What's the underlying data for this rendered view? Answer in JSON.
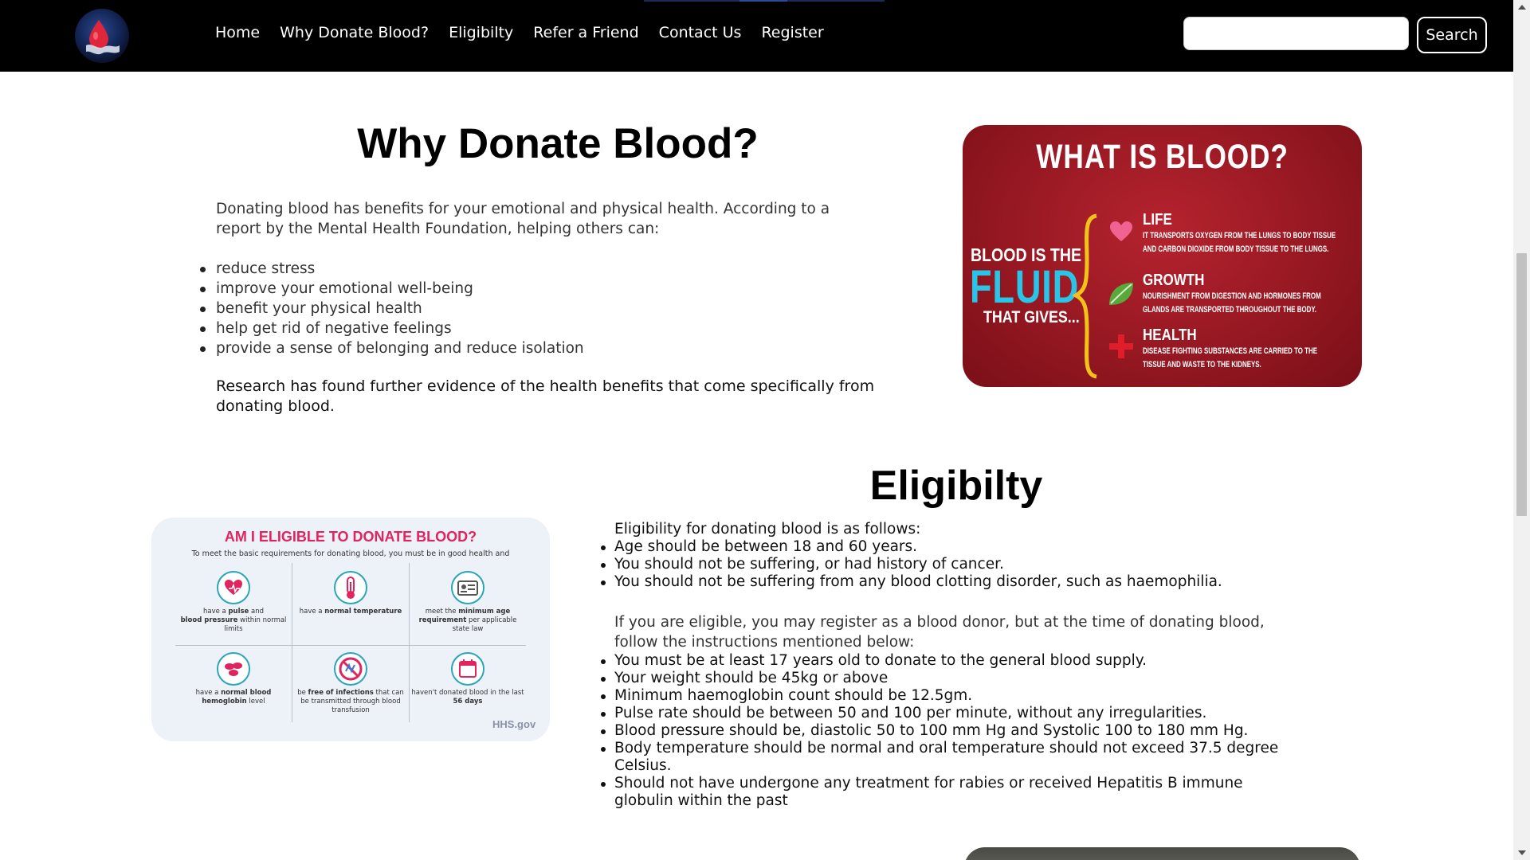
{
  "navbar": {
    "logo_label": "Blood donation logo",
    "links": [
      "Home",
      "Why Donate Blood?",
      "Eligibilty",
      "Refer a Friend",
      "Contact Us",
      "Register"
    ],
    "search_placeholder": "",
    "search_value": "",
    "search_button": "Search"
  },
  "why": {
    "title": "Why Donate Blood?",
    "intro": "Donating blood has benefits for your emotional and physical health. According to a report by the Mental Health Foundation, helping others can:",
    "benefits": [
      "reduce stress",
      "improve your emotional well-being",
      "benefit your physical health",
      "help get rid of negative feelings",
      "provide a sense of belonging and reduce isolation"
    ],
    "research": "Research has found further evidence of the health benefits that come specifically from donating blood."
  },
  "blood_image": {
    "title": "WHAT IS BLOOD?",
    "left_line1": "BLOOD IS THE",
    "left_fluid": "FLUID",
    "left_line3": "THAT GIVES...",
    "items": [
      {
        "heading": "LIFE",
        "line1": "IT TRANSPORTS OXYGEN FROM THE LUNGS TO BODY TISSUE",
        "line2": "AND CARBON DIOXIDE FROM BODY TISSUE TO THE LUNGS."
      },
      {
        "heading": "GROWTH",
        "line1": "NOURISHMENT FROM DIGESTION AND HORMONES FROM",
        "line2": "GLANDS ARE TRANSPORTED THROUGHOUT THE BODY."
      },
      {
        "heading": "HEALTH",
        "line1": "DISEASE FIGHTING SUBSTANCES ARE CARRIED TO THE",
        "line2": "TISSUE AND WASTE TO THE KIDNEYS."
      }
    ],
    "colors": {
      "background": "#9c1a24",
      "fluid": "#29c4e6",
      "brace": "#f2c21b",
      "heart": "#f06292",
      "leaf": "#5aa83c",
      "cross": "#e11d2a"
    }
  },
  "eligibility": {
    "title": "Eligibilty",
    "intro": "Eligibility for donating blood is as follows:",
    "criteria": [
      "Age should be between 18 and 60 years.",
      "You should not be suffering, or had history of cancer.",
      "You should not be suffering from any blood clotting disorder, such as haemophilia."
    ],
    "register_note": "If you are eligible, you may register as a blood donor, but at the time of donating blood, follow the instructions mentioned below:",
    "instructions": [
      "You must be at least 17 years old to donate to the general blood supply.",
      "Your weight should be 45kg or above",
      "Minimum haemoglobin count should be 12.5gm.",
      "Pulse rate should be between 50 and 100 per minute, without any irregularities.",
      "Blood pressure should be, diastolic 50 to 100 mm Hg and Systolic 100 to 180 mm Hg.",
      "Body temperature should be normal and oral temperature should not exceed 37.5 degree Celsius.",
      "Should not have undergone any treatment for rabies or received Hepatitis B immune globulin within the past"
    ]
  },
  "eligible_image": {
    "title": "AM I ELIGIBLE TO DONATE BLOOD?",
    "subtitle": "To meet the basic requirements for donating blood, you must be in good health and",
    "cells": [
      {
        "icon": "heart-pulse-icon",
        "pre": "have a ",
        "b1": "pulse",
        "mid": " and ",
        "b2": "blood pressure",
        "post": " within normal limits"
      },
      {
        "icon": "thermometer-icon",
        "pre": "have a ",
        "b1": "normal temperature",
        "mid": "",
        "b2": "",
        "post": ""
      },
      {
        "icon": "id-card-icon",
        "pre": "meet the ",
        "b1": "minimum age requirement",
        "mid": "",
        "b2": "",
        "post": " per applicable state law"
      },
      {
        "icon": "blood-cells-icon",
        "pre": "have a ",
        "b1": "normal blood hemoglobin",
        "mid": "",
        "b2": "",
        "post": " level"
      },
      {
        "icon": "no-infection-icon",
        "pre": "be ",
        "b1": "free of infections",
        "mid": "",
        "b2": "",
        "post": " that can be transmitted through blood transfusion"
      },
      {
        "icon": "calendar-icon",
        "pre": "haven't donated blood in the last ",
        "b1": "56 days",
        "mid": "",
        "b2": "",
        "post": ""
      }
    ],
    "source": "HHS.gov",
    "colors": {
      "title": "#e0245e",
      "circle": "#2aa6b8",
      "background": "#edf1f8"
    }
  }
}
